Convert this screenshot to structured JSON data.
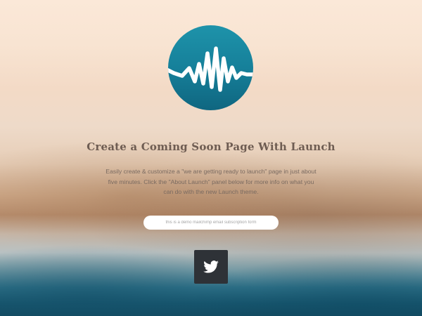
{
  "header": {
    "logo_icon": "soundwave-logo-icon",
    "title": "Create a Coming Soon Page With Launch",
    "description": "Easily create & customize a \"we are getting ready to launch\" page in just about five minutes. Click the \"About Launch\" panel below for more info on what you can do with the new Launch theme."
  },
  "subscribe": {
    "placeholder": "this is a demo mailchimp email subscription form",
    "value": ""
  },
  "social": {
    "twitter_icon": "twitter-icon"
  },
  "colors": {
    "logo_circle": "#1b8aa3",
    "wave_stroke": "#ffffff",
    "title_text": "#6e5c52",
    "social_button": "#2e3237"
  }
}
